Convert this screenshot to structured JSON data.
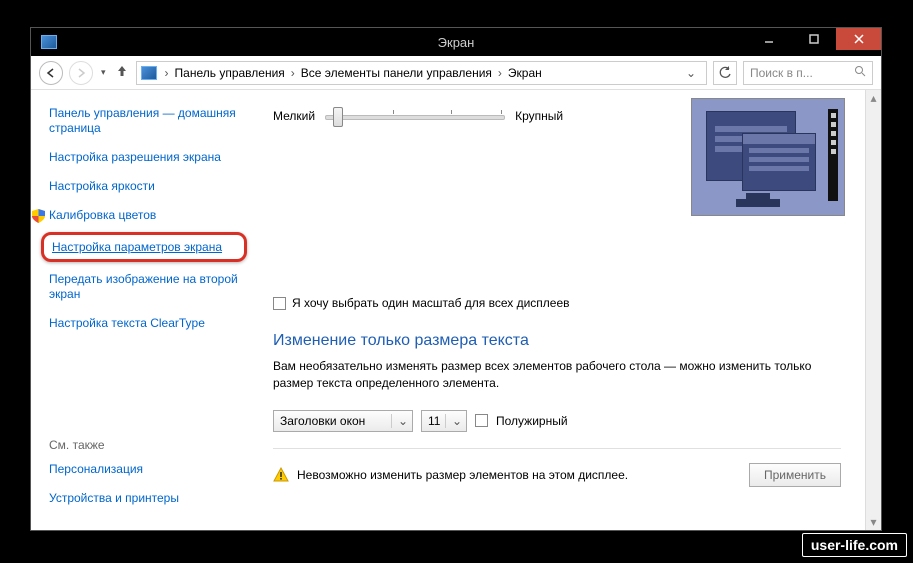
{
  "titlebar": {
    "title": "Экран"
  },
  "breadcrumb": {
    "seg1": "Панель управления",
    "seg2": "Все элементы панели управления",
    "seg3": "Экран"
  },
  "search": {
    "placeholder": "Поиск в п..."
  },
  "sidebar": {
    "home": "Панель управления — домашняя страница",
    "resolution": "Настройка разрешения экрана",
    "brightness": "Настройка яркости",
    "calibration": "Калибровка цветов",
    "screen_params": "Настройка параметров экрана",
    "project": "Передать изображение на второй экран",
    "cleartype": "Настройка текста ClearType",
    "see_also": "См. также",
    "personalization": "Персонализация",
    "devices": "Устройства и принтеры"
  },
  "main": {
    "slider_small": "Мелкий",
    "slider_large": "Крупный",
    "checkbox_one_scale": "Я хочу выбрать один масштаб для всех дисплеев",
    "heading": "Изменение только размера текста",
    "description": "Вам необязательно изменять размер всех элементов рабочего стола — можно изменить только размер текста определенного элемента.",
    "element_combo": "Заголовки окон",
    "size_combo": "11",
    "bold_label": "Полужирный",
    "warning": "Невозможно изменить размер элементов на этом дисплее.",
    "apply": "Применить"
  },
  "watermark": "user-life.com"
}
